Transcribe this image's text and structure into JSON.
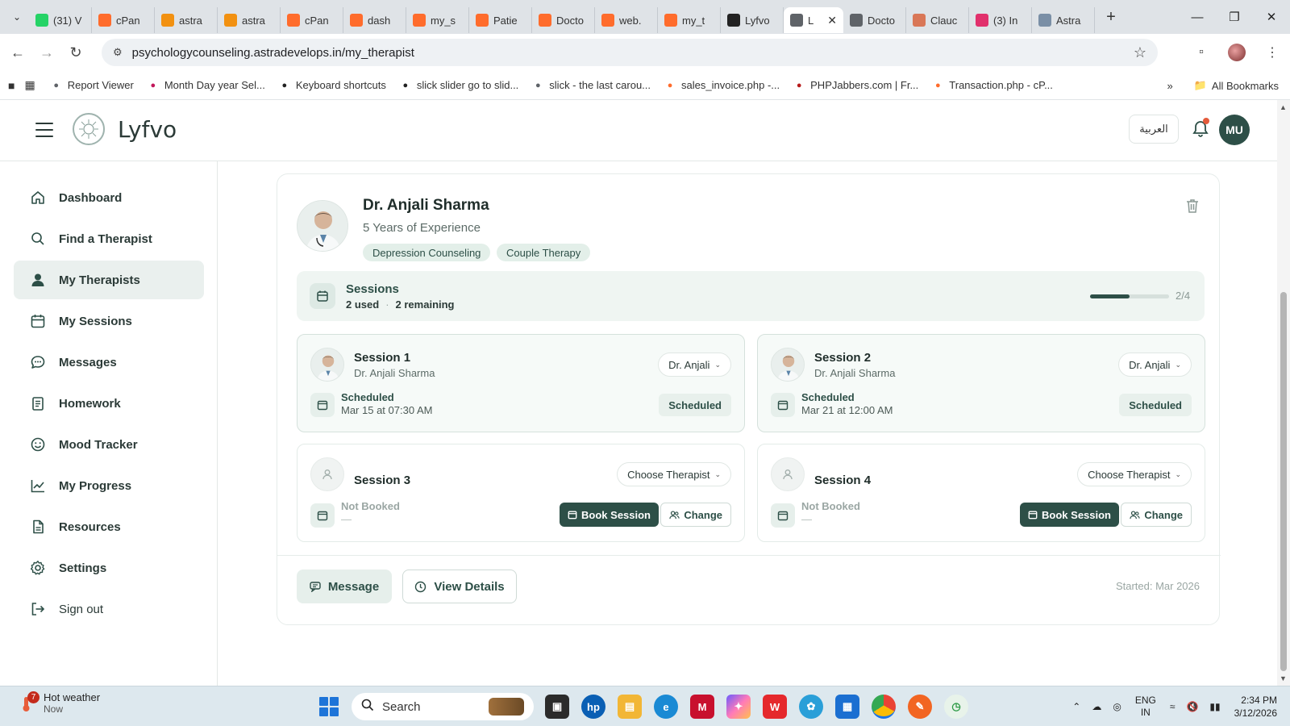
{
  "browser": {
    "tabs": [
      {
        "label": "(31) V",
        "icon": "whatsapp-icon",
        "color": "#25d366"
      },
      {
        "label": "cPan",
        "icon": "cpanel-icon",
        "color": "#ff6c2c"
      },
      {
        "label": "astra",
        "icon": "phpmyadmin-icon",
        "color": "#f29111"
      },
      {
        "label": "astra",
        "icon": "phpmyadmin-icon",
        "color": "#f29111"
      },
      {
        "label": "cPan",
        "icon": "cpanel-icon",
        "color": "#ff6c2c"
      },
      {
        "label": "dash",
        "icon": "cpanel-icon",
        "color": "#ff6c2c"
      },
      {
        "label": "my_s",
        "icon": "cpanel-icon",
        "color": "#ff6c2c"
      },
      {
        "label": "Patie",
        "icon": "cpanel-icon",
        "color": "#ff6c2c"
      },
      {
        "label": "Docto",
        "icon": "cpanel-icon",
        "color": "#ff6c2c"
      },
      {
        "label": "web.",
        "icon": "cpanel-icon",
        "color": "#ff6c2c"
      },
      {
        "label": "my_t",
        "icon": "cpanel-icon",
        "color": "#ff6c2c"
      },
      {
        "label": "Lyfvo",
        "icon": "lyfvo-icon",
        "color": "#222222"
      },
      {
        "label": "L",
        "icon": "globe-icon",
        "color": "#5f6368",
        "active": true
      },
      {
        "label": "Docto",
        "icon": "globe-icon",
        "color": "#5f6368"
      },
      {
        "label": "Clauc",
        "icon": "claude-icon",
        "color": "#d97757"
      },
      {
        "label": "(3) In",
        "icon": "instagram-icon",
        "color": "#e1306c"
      },
      {
        "label": "Astra",
        "icon": "astra-icon",
        "color": "#7a8fa6"
      }
    ],
    "url": "psychologycounseling.astradevelops.in/my_therapist",
    "bookmarks": [
      {
        "label": "Report Viewer",
        "icon": "globe-icon"
      },
      {
        "label": "Month Day year Sel...",
        "icon": "pm-icon"
      },
      {
        "label": "Keyboard shortcuts",
        "icon": "github-icon"
      },
      {
        "label": "slick slider go to slid...",
        "icon": "codepen-icon"
      },
      {
        "label": "slick - the last carou...",
        "icon": "globe-icon"
      },
      {
        "label": "sales_invoice.php -...",
        "icon": "cpanel-icon"
      },
      {
        "label": "PHPJabbers.com | Fr...",
        "icon": "ja-icon"
      },
      {
        "label": "Transaction.php - cP...",
        "icon": "cpanel-icon"
      }
    ],
    "all_bookmarks": "All Bookmarks"
  },
  "header": {
    "brand": "Lyfvo",
    "language_button": "العربية",
    "user_initials": "MU"
  },
  "sidebar": {
    "items": [
      {
        "label": "Dashboard",
        "icon": "home-icon"
      },
      {
        "label": "Find a Therapist",
        "icon": "search-icon"
      },
      {
        "label": "My Therapists",
        "icon": "user-icon",
        "active": true
      },
      {
        "label": "My Sessions",
        "icon": "calendar-icon"
      },
      {
        "label": "Messages",
        "icon": "chat-icon"
      },
      {
        "label": "Homework",
        "icon": "clipboard-icon"
      },
      {
        "label": "Mood Tracker",
        "icon": "smile-icon"
      },
      {
        "label": "My Progress",
        "icon": "chart-icon"
      },
      {
        "label": "Resources",
        "icon": "document-icon"
      },
      {
        "label": "Settings",
        "icon": "gear-icon"
      },
      {
        "label": "Sign out",
        "icon": "logout-icon"
      }
    ]
  },
  "therapist": {
    "name": "Dr. Anjali Sharma",
    "experience": "5 Years of Experience",
    "specialties": [
      "Depression Counseling",
      "Couple Therapy"
    ],
    "sessions": {
      "title": "Sessions",
      "used": "2 used",
      "remaining": "2 remaining",
      "progress_label": "2/4",
      "progress_fraction": 0.5
    },
    "session_cards": [
      {
        "title": "Session 1",
        "therapist": "Dr. Anjali Sharma",
        "selector": "Dr. Anjali",
        "status": "Scheduled",
        "date": "Mar 15 at 07:30 AM",
        "badge": "Scheduled"
      },
      {
        "title": "Session 2",
        "therapist": "Dr. Anjali Sharma",
        "selector": "Dr. Anjali",
        "status": "Scheduled",
        "date": "Mar 21 at 12:00 AM",
        "badge": "Scheduled"
      },
      {
        "title": "Session 3",
        "selector": "Choose Therapist",
        "status": "Not Booked",
        "date": "—",
        "book_label": "Book Session",
        "change_label": "Change"
      },
      {
        "title": "Session 4",
        "selector": "Choose Therapist",
        "status": "Not Booked",
        "date": "—",
        "book_label": "Book Session",
        "change_label": "Change"
      }
    ],
    "message_button": "Message",
    "details_button": "View Details",
    "started": "Started: Mar 2026"
  },
  "taskbar": {
    "weather_title": "Hot weather",
    "weather_sub": "Now",
    "weather_badge": "7",
    "search_placeholder": "Search",
    "lang_top": "ENG",
    "lang_bottom": "IN",
    "time": "2:34 PM",
    "date": "3/12/2026"
  },
  "colors": {
    "primary": "#2d4f47",
    "chip_bg": "#e3efe9",
    "sessions_bg": "#eff5f2",
    "active_nav_bg": "#eaf0ee"
  }
}
